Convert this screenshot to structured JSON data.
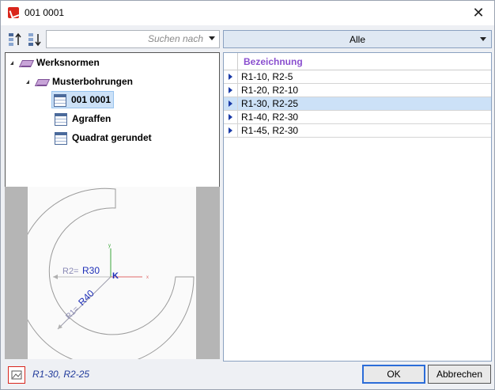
{
  "window": {
    "title": "001 0001"
  },
  "toolbar": {
    "search_placeholder": "Suchen nach",
    "filter_value": "Alle"
  },
  "tree": {
    "nodes": [
      {
        "label": "Werksnormen"
      },
      {
        "label": "Musterbohrungen"
      },
      {
        "label": "001 0001"
      },
      {
        "label": "Agraffen"
      },
      {
        "label": "Quadrat gerundet"
      }
    ]
  },
  "preview": {
    "r2_label": "R2=",
    "r2_value": "R30",
    "r1_label": "R1=",
    "r1_value": "R40",
    "origin_label": "K",
    "axis_x": "x",
    "axis_y": "y"
  },
  "list": {
    "header": "Bezeichnung",
    "rows": [
      {
        "label": "R1-10, R2-5"
      },
      {
        "label": "R1-20, R2-10"
      },
      {
        "label": "R1-30, R2-25"
      },
      {
        "label": "R1-40, R2-30"
      },
      {
        "label": "R1-45, R2-30"
      }
    ],
    "selected_index": 2
  },
  "status": {
    "text": "R1-30, R2-25"
  },
  "buttons": {
    "ok": "OK",
    "cancel": "Abbrechen"
  },
  "colors": {
    "accent": "#2b6cd8",
    "selection": "#cce1f7",
    "header_text": "#8a4fcf",
    "status_text": "#203a9b",
    "brand": "#d9261c"
  }
}
